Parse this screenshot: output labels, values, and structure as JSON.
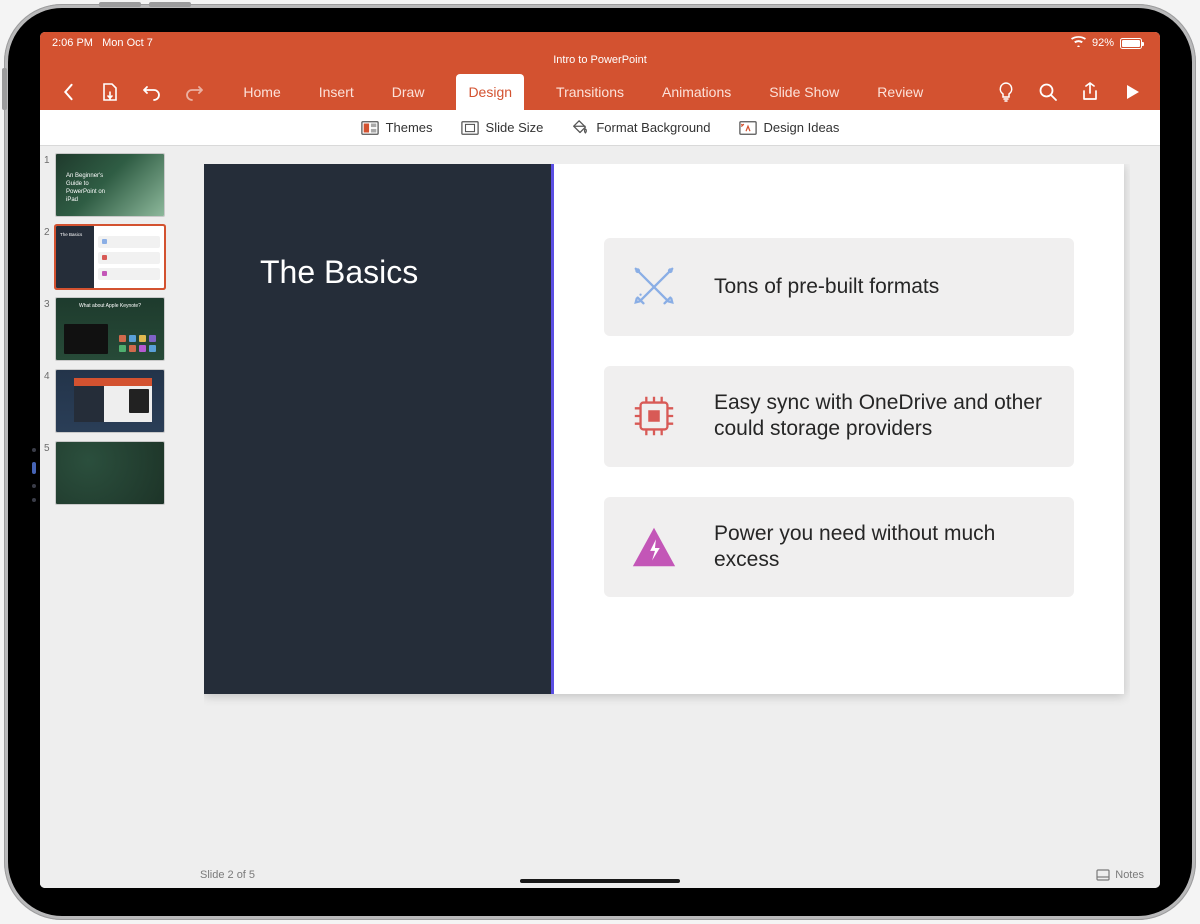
{
  "status": {
    "time": "2:06 PM",
    "date": "Mon Oct 7",
    "battery_pct": "92%"
  },
  "doc_title": "Intro to PowerPoint",
  "tabs": {
    "home": "Home",
    "insert": "Insert",
    "draw": "Draw",
    "design": "Design",
    "transitions": "Transitions",
    "animations": "Animations",
    "slideshow": "Slide Show",
    "review": "Review"
  },
  "subribbon": {
    "themes": "Themes",
    "slide_size": "Slide Size",
    "format_bg": "Format Background",
    "design_ideas": "Design Ideas"
  },
  "thumbs": {
    "t1_l1": "An Beginner's",
    "t1_l2": "Guide to",
    "t1_l3": "PowerPoint on",
    "t1_l4": "iPad",
    "t2_title": "The Basics",
    "t3_title": "What about Apple Keynote?"
  },
  "slide": {
    "title": "The Basics",
    "card1": "Tons of pre-built formats",
    "card2": "Easy sync with OneDrive and other could storage providers",
    "card3": "Power you need without much excess"
  },
  "footer": {
    "slide_pos": "Slide 2 of 5",
    "notes": "Notes"
  },
  "colors": {
    "brand": "#d35230",
    "slide_dark": "#252d39",
    "card_bg": "#f0efef",
    "icon_blue": "#8aaee5",
    "icon_red": "#d85a56",
    "icon_magenta": "#c356b7"
  }
}
